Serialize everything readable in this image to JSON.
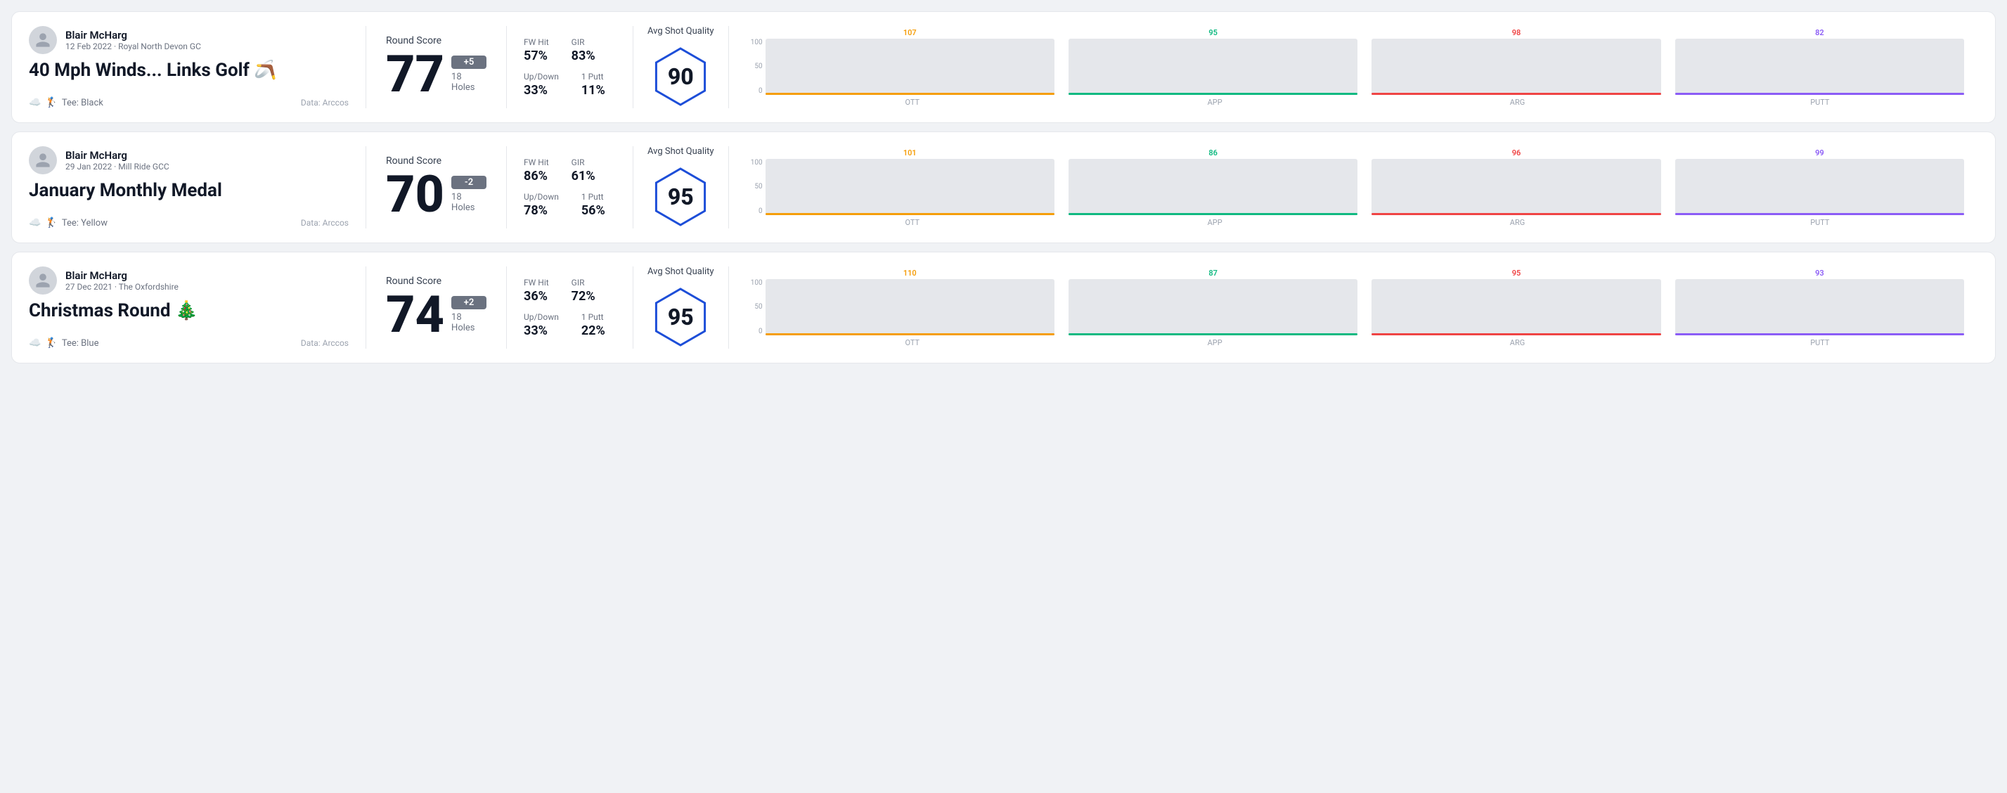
{
  "rounds": [
    {
      "id": "round1",
      "user": {
        "name": "Blair McHarg",
        "meta": "12 Feb 2022 · Royal North Devon GC"
      },
      "title": "40 Mph Winds... Links Golf 🪃",
      "tee": "Black",
      "data_source": "Data: Arccos",
      "score": {
        "label": "Round Score",
        "number": "77",
        "badge": "+5",
        "badge_type": "positive",
        "holes": "18 Holes"
      },
      "stats": {
        "fw_hit_label": "FW Hit",
        "fw_hit_value": "57%",
        "gir_label": "GIR",
        "gir_value": "83%",
        "updown_label": "Up/Down",
        "updown_value": "33%",
        "oneputt_label": "1 Putt",
        "oneputt_value": "11%"
      },
      "quality": {
        "label": "Avg Shot Quality",
        "score": "90"
      },
      "chart": {
        "bars": [
          {
            "label": "OTT",
            "value": 107,
            "color": "#f59e0b",
            "pct": 85
          },
          {
            "label": "APP",
            "value": 95,
            "color": "#10b981",
            "pct": 70
          },
          {
            "label": "ARG",
            "value": 98,
            "color": "#ef4444",
            "pct": 75
          },
          {
            "label": "PUTT",
            "value": 82,
            "color": "#8b5cf6",
            "pct": 62
          }
        ]
      }
    },
    {
      "id": "round2",
      "user": {
        "name": "Blair McHarg",
        "meta": "29 Jan 2022 · Mill Ride GCC"
      },
      "title": "January Monthly Medal",
      "tee": "Yellow",
      "data_source": "Data: Arccos",
      "score": {
        "label": "Round Score",
        "number": "70",
        "badge": "-2",
        "badge_type": "negative",
        "holes": "18 Holes"
      },
      "stats": {
        "fw_hit_label": "FW Hit",
        "fw_hit_value": "86%",
        "gir_label": "GIR",
        "gir_value": "61%",
        "updown_label": "Up/Down",
        "updown_value": "78%",
        "oneputt_label": "1 Putt",
        "oneputt_value": "56%"
      },
      "quality": {
        "label": "Avg Shot Quality",
        "score": "95"
      },
      "chart": {
        "bars": [
          {
            "label": "OTT",
            "value": 101,
            "color": "#f59e0b",
            "pct": 80
          },
          {
            "label": "APP",
            "value": 86,
            "color": "#10b981",
            "pct": 65
          },
          {
            "label": "ARG",
            "value": 96,
            "color": "#ef4444",
            "pct": 75
          },
          {
            "label": "PUTT",
            "value": 99,
            "color": "#8b5cf6",
            "pct": 78
          }
        ]
      }
    },
    {
      "id": "round3",
      "user": {
        "name": "Blair McHarg",
        "meta": "27 Dec 2021 · The Oxfordshire"
      },
      "title": "Christmas Round 🎄",
      "tee": "Blue",
      "data_source": "Data: Arccos",
      "score": {
        "label": "Round Score",
        "number": "74",
        "badge": "+2",
        "badge_type": "positive",
        "holes": "18 Holes"
      },
      "stats": {
        "fw_hit_label": "FW Hit",
        "fw_hit_value": "36%",
        "gir_label": "GIR",
        "gir_value": "72%",
        "updown_label": "Up/Down",
        "updown_value": "33%",
        "oneputt_label": "1 Putt",
        "oneputt_value": "22%"
      },
      "quality": {
        "label": "Avg Shot Quality",
        "score": "95"
      },
      "chart": {
        "bars": [
          {
            "label": "OTT",
            "value": 110,
            "color": "#f59e0b",
            "pct": 88
          },
          {
            "label": "APP",
            "value": 87,
            "color": "#10b981",
            "pct": 66
          },
          {
            "label": "ARG",
            "value": 95,
            "color": "#ef4444",
            "pct": 74
          },
          {
            "label": "PUTT",
            "value": 93,
            "color": "#8b5cf6",
            "pct": 72
          }
        ]
      }
    }
  ],
  "y_axis": {
    "top": "100",
    "mid": "50",
    "bottom": "0"
  }
}
